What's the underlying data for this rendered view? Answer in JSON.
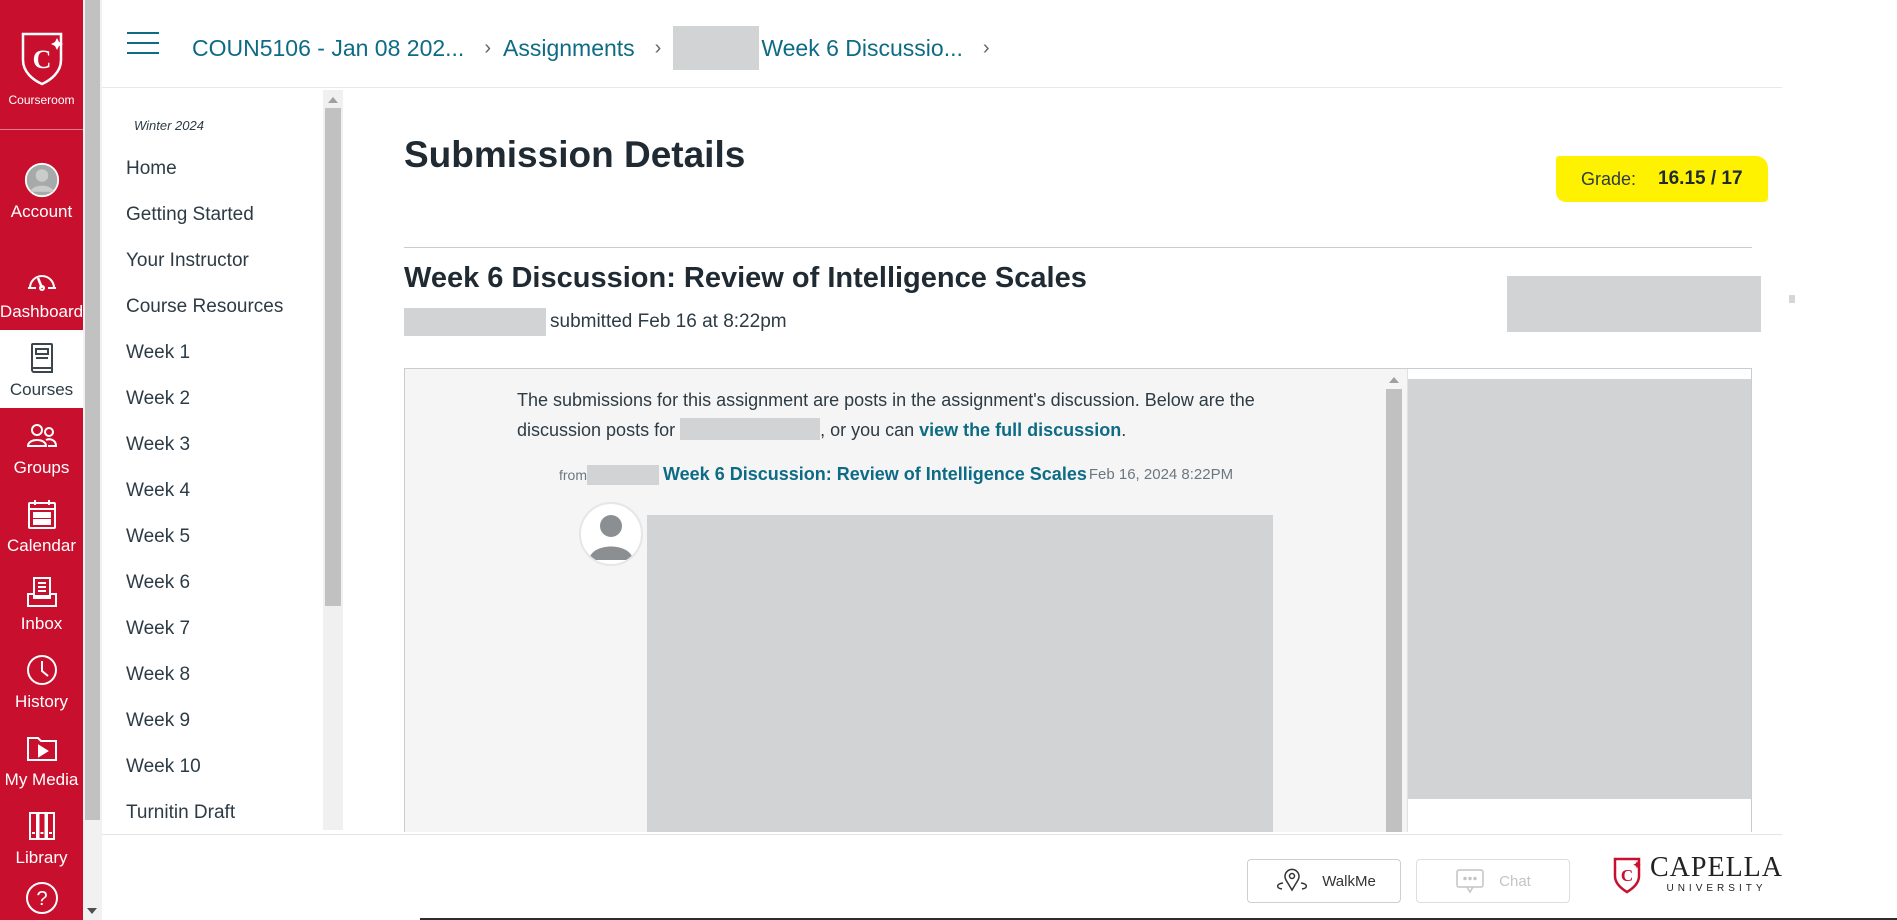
{
  "global_nav": {
    "logo_label": "Courseroom",
    "items": [
      {
        "label": "Account",
        "icon": "account-avatar-icon"
      },
      {
        "label": "Dashboard",
        "icon": "dashboard-gauge-icon"
      },
      {
        "label": "Courses",
        "icon": "courses-book-icon",
        "active": true
      },
      {
        "label": "Groups",
        "icon": "groups-icon"
      },
      {
        "label": "Calendar",
        "icon": "calendar-icon"
      },
      {
        "label": "Inbox",
        "icon": "inbox-icon"
      },
      {
        "label": "History",
        "icon": "history-clock-icon"
      },
      {
        "label": "My Media",
        "icon": "media-folder-icon"
      },
      {
        "label": "Library",
        "icon": "library-books-icon"
      },
      {
        "label": "Help",
        "icon": "help-question-icon"
      }
    ]
  },
  "breadcrumb": {
    "course": "COUN5106 - Jan 08 202...",
    "assignments": "Assignments",
    "assignment": "Week 6 Discussio..."
  },
  "course_nav": {
    "term": "Winter 2024",
    "items": [
      "Home",
      "Getting Started",
      "Your Instructor",
      "Course Resources",
      "Week 1",
      "Week 2",
      "Week 3",
      "Week 4",
      "Week 5",
      "Week 6",
      "Week 7",
      "Week 8",
      "Week 9",
      "Week 10",
      "Turnitin Draft"
    ]
  },
  "main": {
    "page_title": "Submission Details",
    "grade_label": "Grade:",
    "grade_value": "16.15 / 17",
    "grade_highlight_color": "#fff200",
    "assignment_title": "Week 6 Discussion: Review of Intelligence Scales",
    "submitted_text": "submitted Feb 16 at 8:22pm",
    "discussion": {
      "intro_part1": "The submissions for this assignment are posts in the assignment's discussion. Below are the discussion posts for ",
      "intro_part2": ", or you can ",
      "intro_link": "view the full discussion",
      "intro_end": ".",
      "from_label": "from",
      "post_link": "Week 6 Discussion: Review of Intelligence Scales",
      "post_timestamp": "Feb 16, 2024 8:22PM"
    }
  },
  "footer": {
    "walkme_label": "WalkMe",
    "chat_label": "Chat",
    "logo_name": "CAPELLA",
    "logo_sub": "UNIVERSITY"
  },
  "colors": {
    "brand_red": "#c8102e",
    "link_teal": "#0e6b86",
    "text": "#2d3b45"
  }
}
